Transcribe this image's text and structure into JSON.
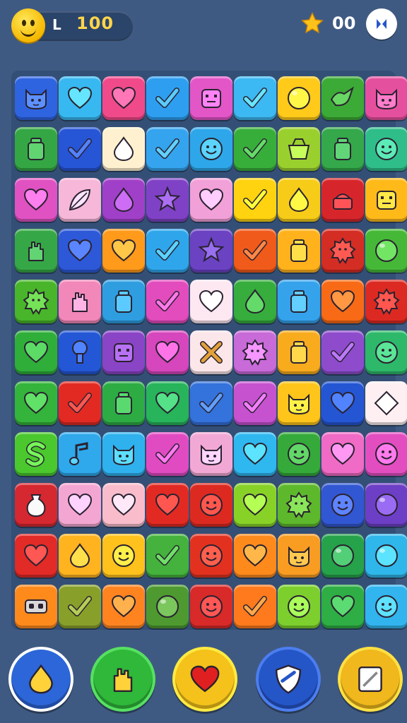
{
  "hud": {
    "level_label": "L",
    "score": "100",
    "stars": "00",
    "face_icon": "smiley-face-icon",
    "star_icon": "star-icon",
    "menu_icon": "menu-icon"
  },
  "colors": {
    "background": "#3f5a82",
    "score": "#ffd54a"
  },
  "board": {
    "rows": [
      [
        {
          "color": "#2f64e0",
          "icon": "cat"
        },
        {
          "color": "#38b8f0",
          "icon": "heart"
        },
        {
          "color": "#f04a8a",
          "icon": "heart"
        },
        {
          "color": "#2e9ff0",
          "icon": "check"
        },
        {
          "color": "#e356c8",
          "icon": "box"
        },
        {
          "color": "#3cb8f2",
          "icon": "check"
        },
        {
          "color": "#ffca1a",
          "icon": "circle"
        },
        {
          "color": "#3caa36",
          "icon": "bird"
        },
        {
          "color": "#e5509e",
          "icon": "cat"
        }
      ],
      [
        {
          "color": "#34a744",
          "icon": "jar"
        },
        {
          "color": "#2655d6",
          "icon": "check"
        },
        {
          "color": "#fff1d0",
          "icon": "drop"
        },
        {
          "color": "#35a4ef",
          "icon": "check"
        },
        {
          "color": "#2ea7ea",
          "icon": "face"
        },
        {
          "color": "#38ae3a",
          "icon": "check"
        },
        {
          "color": "#9ad02e",
          "icon": "basket"
        },
        {
          "color": "#34a84a",
          "icon": "jar"
        },
        {
          "color": "#2fbe8a",
          "icon": "face"
        }
      ],
      [
        {
          "color": "#e052c2",
          "icon": "heart"
        },
        {
          "color": "#f6b7d8",
          "icon": "leaf"
        },
        {
          "color": "#a040c8",
          "icon": "drop"
        },
        {
          "color": "#7f42c6",
          "icon": "star"
        },
        {
          "color": "#f2a0d8",
          "icon": "heart"
        },
        {
          "color": "#ffd30f",
          "icon": "check"
        },
        {
          "color": "#f7cc18",
          "icon": "drop"
        },
        {
          "color": "#d7262b",
          "icon": "cake"
        },
        {
          "color": "#ffba1a",
          "icon": "box"
        }
      ],
      [
        {
          "color": "#36a746",
          "icon": "hand"
        },
        {
          "color": "#2d58d8",
          "icon": "heart"
        },
        {
          "color": "#ff9a1a",
          "icon": "heart"
        },
        {
          "color": "#2fa6ec",
          "icon": "check"
        },
        {
          "color": "#6a42c2",
          "icon": "star"
        },
        {
          "color": "#f05a1a",
          "icon": "check"
        },
        {
          "color": "#ffb21c",
          "icon": "jar"
        },
        {
          "color": "#d42d24",
          "icon": "gear"
        },
        {
          "color": "#46b838",
          "icon": "circle"
        }
      ],
      [
        {
          "color": "#48b52a",
          "icon": "gear"
        },
        {
          "color": "#f287b9",
          "icon": "hand"
        },
        {
          "color": "#2e9ee0",
          "icon": "jar"
        },
        {
          "color": "#e24cbd",
          "icon": "check"
        },
        {
          "color": "#fde7f0",
          "icon": "heart"
        },
        {
          "color": "#36ad3c",
          "icon": "drop"
        },
        {
          "color": "#35a2ec",
          "icon": "jar"
        },
        {
          "color": "#f86a16",
          "icon": "heart"
        },
        {
          "color": "#dc2a22",
          "icon": "gear"
        }
      ],
      [
        {
          "color": "#2fae3a",
          "icon": "heart"
        },
        {
          "color": "#2457d6",
          "icon": "tree"
        },
        {
          "color": "#8a44c6",
          "icon": "box"
        },
        {
          "color": "#d646bc",
          "icon": "heart"
        },
        {
          "color": "#fbe6ea",
          "icon": "cross"
        },
        {
          "color": "#c86ad8",
          "icon": "gear"
        },
        {
          "color": "#f9ab1e",
          "icon": "jar"
        },
        {
          "color": "#8e4ccc",
          "icon": "check"
        },
        {
          "color": "#2eb86a",
          "icon": "face"
        }
      ],
      [
        {
          "color": "#34b43a",
          "icon": "heart"
        },
        {
          "color": "#e22a23",
          "icon": "check"
        },
        {
          "color": "#2dac44",
          "icon": "jar"
        },
        {
          "color": "#27b45a",
          "icon": "heart"
        },
        {
          "color": "#3472dc",
          "icon": "check"
        },
        {
          "color": "#c652d0",
          "icon": "check"
        },
        {
          "color": "#ffc51a",
          "icon": "cat"
        },
        {
          "color": "#2456d4",
          "icon": "heart"
        },
        {
          "color": "#fdeff2",
          "icon": "diamond"
        }
      ],
      [
        {
          "color": "#4ac82e",
          "icon": "s"
        },
        {
          "color": "#2fa8ec",
          "icon": "note"
        },
        {
          "color": "#2fb1ee",
          "icon": "cat"
        },
        {
          "color": "#e04bc2",
          "icon": "check"
        },
        {
          "color": "#f2a8d5",
          "icon": "cat"
        },
        {
          "color": "#2fb7f0",
          "icon": "heart"
        },
        {
          "color": "#35aa3a",
          "icon": "face"
        },
        {
          "color": "#f06bc5",
          "icon": "heart"
        },
        {
          "color": "#e24ec0",
          "icon": "face"
        }
      ],
      [
        {
          "color": "#d62830",
          "icon": "vase"
        },
        {
          "color": "#f4a6d2",
          "icon": "heart"
        },
        {
          "color": "#f8bccb",
          "icon": "heart"
        },
        {
          "color": "#e22a23",
          "icon": "heart"
        },
        {
          "color": "#dc2a20",
          "icon": "face"
        },
        {
          "color": "#88d228",
          "icon": "heart"
        },
        {
          "color": "#5eb82c",
          "icon": "gear"
        },
        {
          "color": "#3257d2",
          "icon": "face"
        },
        {
          "color": "#6d3fc6",
          "icon": "circle"
        }
      ],
      [
        {
          "color": "#e22a26",
          "icon": "heart"
        },
        {
          "color": "#ffb31e",
          "icon": "drop"
        },
        {
          "color": "#ffc21c",
          "icon": "face"
        },
        {
          "color": "#44b23c",
          "icon": "check"
        },
        {
          "color": "#e2321f",
          "icon": "face"
        },
        {
          "color": "#ff8a1c",
          "icon": "heart"
        },
        {
          "color": "#f89c22",
          "icon": "cat"
        },
        {
          "color": "#26a24a",
          "icon": "circle"
        },
        {
          "color": "#2fb6ea",
          "icon": "circle"
        }
      ],
      [
        {
          "color": "#ff8a1c",
          "icon": "robot"
        },
        {
          "color": "#88a02a",
          "icon": "check"
        },
        {
          "color": "#ff8420",
          "icon": "heart"
        },
        {
          "color": "#4e9a30",
          "icon": "circle"
        },
        {
          "color": "#d82a28",
          "icon": "face"
        },
        {
          "color": "#ff7a1c",
          "icon": "check"
        },
        {
          "color": "#7ccf2c",
          "icon": "face"
        },
        {
          "color": "#2eae44",
          "icon": "heart"
        },
        {
          "color": "#32b4ee",
          "icon": "face"
        }
      ]
    ]
  },
  "powerups": [
    {
      "name": "lollipop-booster",
      "icon": "drop",
      "color": "#2c66d8"
    },
    {
      "name": "glove-booster",
      "icon": "hand",
      "color": "#2fb83a"
    },
    {
      "name": "apple-booster",
      "icon": "heart",
      "color": "#f4c21a"
    },
    {
      "name": "shield-booster",
      "icon": "shield",
      "color": "#2456c8"
    },
    {
      "name": "card-booster",
      "icon": "card",
      "color": "#f0b81c"
    }
  ]
}
